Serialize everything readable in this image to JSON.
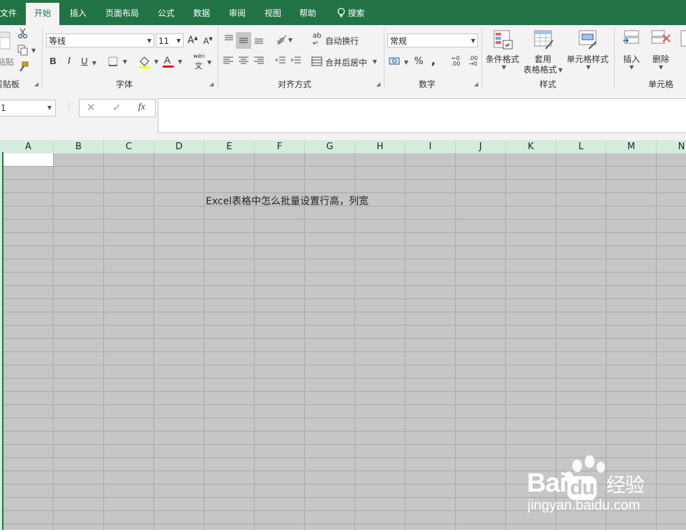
{
  "tabs": [
    "文件",
    "开始",
    "插入",
    "页面布局",
    "公式",
    "数据",
    "审阅",
    "视图",
    "帮助",
    "搜索"
  ],
  "ribbon": {
    "clipboard": {
      "paste_label": "粘贴",
      "group_label": "剪贴板"
    },
    "font": {
      "font_name": "等线",
      "font_size": "11",
      "group_label": "字体",
      "bold": "B",
      "italic": "I",
      "underline": "U",
      "pinyin_top": "wén",
      "pinyin_bottom": "文"
    },
    "alignment": {
      "wrap_text": "自动换行",
      "merge_center": "合并后居中",
      "group_label": "对齐方式"
    },
    "number": {
      "format": "常规",
      "percent": "%",
      "comma": ",",
      "group_label": "数字"
    },
    "styles": {
      "conditional": "条件格式",
      "table_line1": "套用",
      "table_line2": "表格格式",
      "cell_styles": "单元格样式",
      "group_label": "样式"
    },
    "cells": {
      "insert": "插入",
      "delete": "删除",
      "group_label": "单元格"
    }
  },
  "formula_bar": {
    "name_box": "1",
    "formula": ""
  },
  "columns": [
    "A",
    "B",
    "C",
    "D",
    "E",
    "F",
    "G",
    "H",
    "I",
    "J",
    "K",
    "L",
    "M",
    "N"
  ],
  "cell_text": "Excel表格中怎么批量设置行高，列宽",
  "watermark": {
    "line1": "Bai",
    "line2": "经验",
    "url": "jingyan.baidu.com"
  },
  "colors": {
    "accent": "#217346",
    "grid_bg": "#c6c6c6",
    "header_bg": "#d3ecdc"
  }
}
